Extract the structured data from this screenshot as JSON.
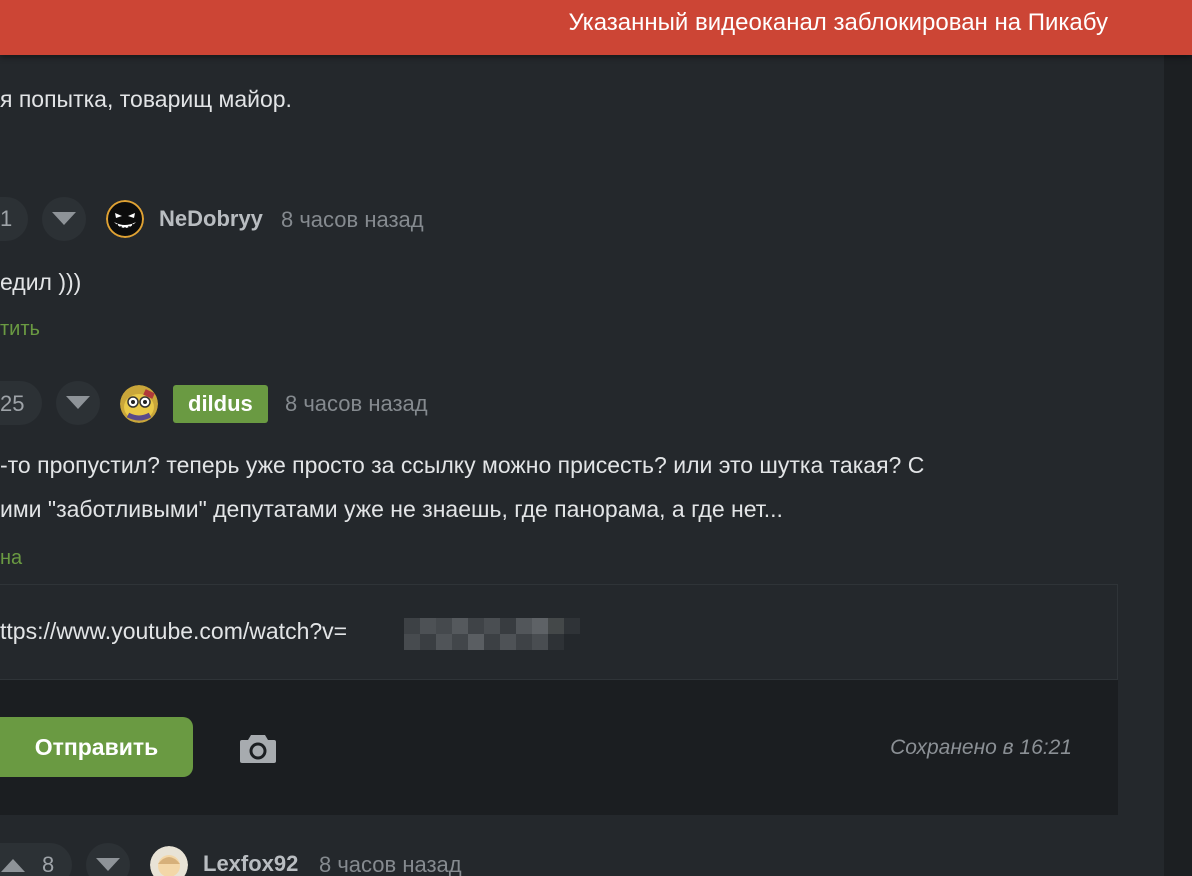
{
  "toast": {
    "message": "Указанный видеоканал заблокирован на Пикабу"
  },
  "comments": [
    {
      "text_lines": [
        "я попытка, товарищ майор."
      ]
    },
    {
      "rating": "1",
      "author": "NeDobryy",
      "time": "8 часов назад",
      "text_lines": [
        "едил )))"
      ],
      "action": "тить"
    },
    {
      "rating": "25",
      "author": "dildus",
      "time": "8 часов назад",
      "text_lines": [
        "-то пропустил? теперь уже просто за ссылку можно присесть? или это шутка такая? С",
        "ими \"заботливыми\" депутатами уже не знаешь, где панорама, а где нет..."
      ],
      "action": "на"
    },
    {
      "rating": "8",
      "author": "Lexfox92",
      "time": "8 часов назад"
    }
  ],
  "reply_editor": {
    "value": "ttps://www.youtube.com/watch?v=",
    "send_label": "Отправить",
    "saved_status": "Сохранено в 16:21"
  },
  "icons": {
    "upvote": "chevron-up-icon",
    "downvote": "chevron-down-icon",
    "camera": "camera-icon"
  },
  "colors": {
    "accent_green": "#6a9a42",
    "toast_red": "#cc4535",
    "background": "#24282c"
  }
}
